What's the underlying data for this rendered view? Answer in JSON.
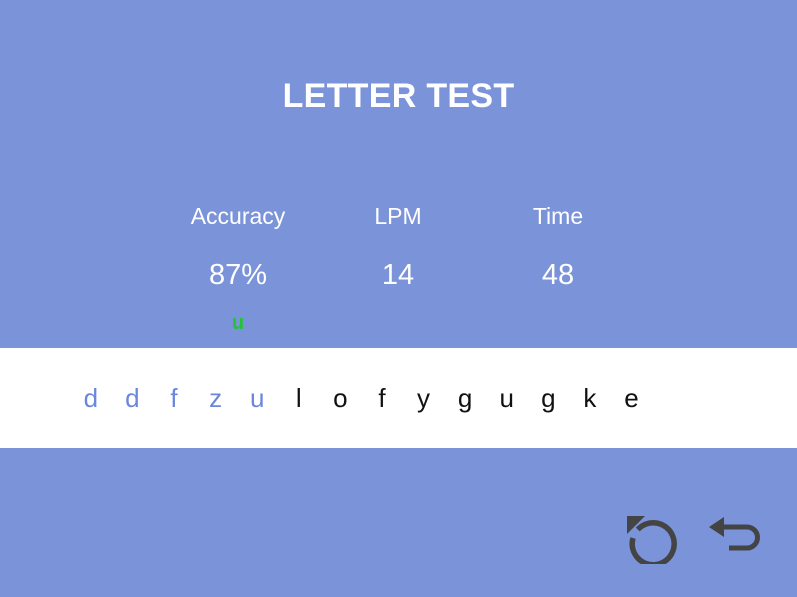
{
  "title": "LETTER TEST",
  "stats": [
    {
      "label": "Accuracy",
      "value": "87%"
    },
    {
      "label": "LPM",
      "value": "14"
    },
    {
      "label": "Time",
      "value": "48"
    }
  ],
  "last_typed": "u",
  "letters": [
    {
      "char": "d",
      "state": "done"
    },
    {
      "char": "d",
      "state": "done"
    },
    {
      "char": "f",
      "state": "done"
    },
    {
      "char": "z",
      "state": "done"
    },
    {
      "char": "u",
      "state": "done"
    },
    {
      "char": "l",
      "state": "pending"
    },
    {
      "char": "o",
      "state": "pending"
    },
    {
      "char": "f",
      "state": "pending"
    },
    {
      "char": "y",
      "state": "pending"
    },
    {
      "char": "g",
      "state": "pending"
    },
    {
      "char": "u",
      "state": "pending"
    },
    {
      "char": "g",
      "state": "pending"
    },
    {
      "char": "k",
      "state": "pending"
    },
    {
      "char": "e",
      "state": "pending"
    }
  ],
  "buttons": {
    "restart_icon": "restart-icon",
    "back_icon": "back-arrow-icon"
  },
  "colors": {
    "background": "#7b93d9",
    "typed_letter": "#6b86dd",
    "pending_letter": "#111111",
    "last_typed": "#22c534",
    "icon": "#444444"
  }
}
